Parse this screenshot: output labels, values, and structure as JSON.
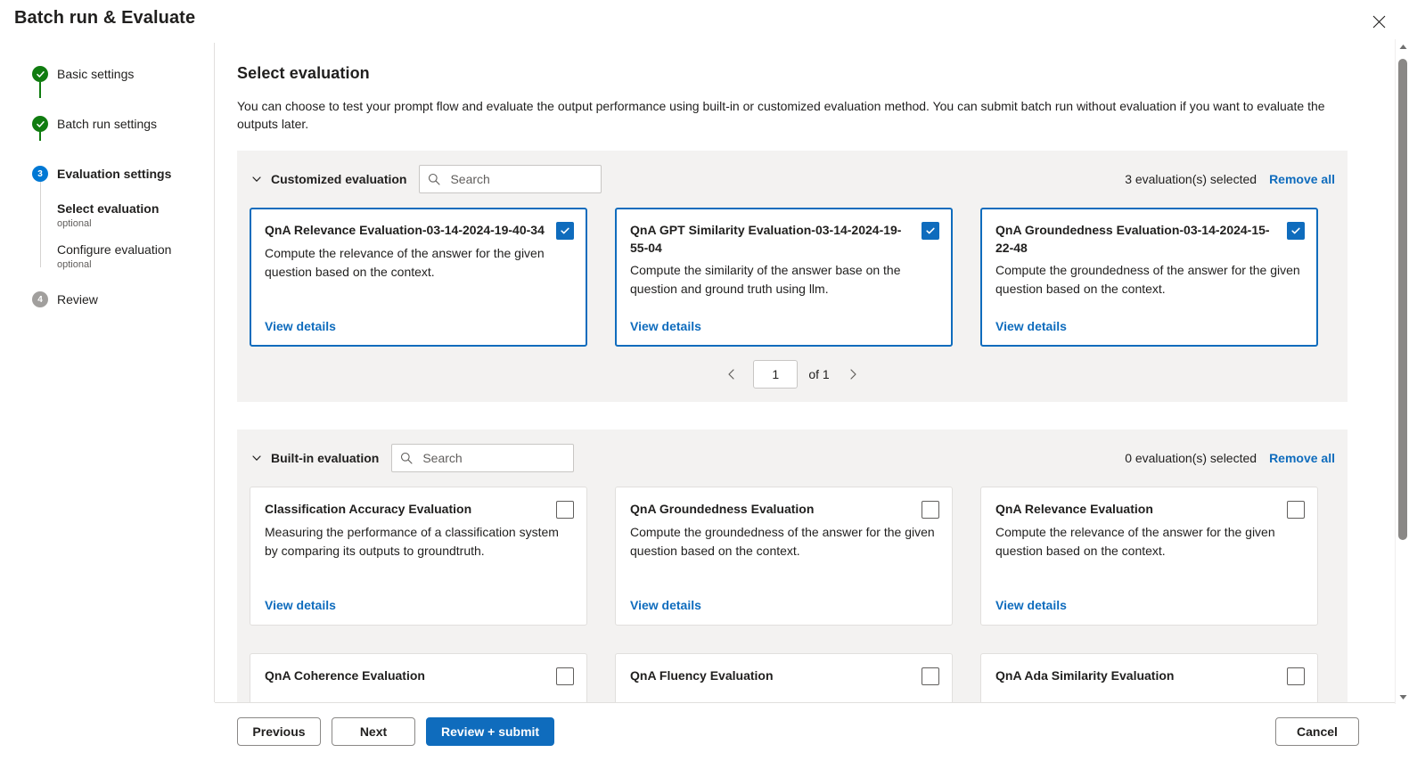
{
  "header": {
    "title": "Batch run & Evaluate",
    "close_icon": "close-icon"
  },
  "sidebar": {
    "steps": [
      {
        "label": "Basic settings",
        "state": "done",
        "marker": "check-icon"
      },
      {
        "label": "Batch run settings",
        "state": "done",
        "marker": "check-icon"
      },
      {
        "label": "Evaluation settings",
        "state": "active",
        "marker": "3"
      }
    ],
    "substeps": [
      {
        "title": "Select evaluation",
        "optional": "optional",
        "active": true
      },
      {
        "title": "Configure evaluation",
        "optional": "optional",
        "active": false
      }
    ],
    "final_step": {
      "label": "Review",
      "state": "future",
      "marker": "4"
    }
  },
  "main": {
    "title": "Select evaluation",
    "description": "You can choose to test your prompt flow and evaluate the output performance using built-in or customized evaluation method. You can submit batch run without evaluation if you want to evaluate the outputs later."
  },
  "customized": {
    "section_label": "Customized evaluation",
    "chevron_icon": "chevron-down-icon",
    "search_placeholder": "Search",
    "search_value": "",
    "search_icon": "search-icon",
    "selected_text": "3 evaluation(s) selected",
    "remove_all_label": "Remove all",
    "cards": [
      {
        "title": "QnA Relevance Evaluation-03-14-2024-19-40-34",
        "description": "Compute the relevance of the answer for the given question based on the context.",
        "link_label": "View details",
        "checked": true
      },
      {
        "title": "QnA GPT Similarity Evaluation-03-14-2024-19-55-04",
        "description": "Compute the similarity of the answer base on the question and ground truth using llm.",
        "link_label": "View details",
        "checked": true
      },
      {
        "title": "QnA Groundedness Evaluation-03-14-2024-15-22-48",
        "description": "Compute the groundedness of the answer for the given question based on the context.",
        "link_label": "View details",
        "checked": true
      }
    ],
    "pager": {
      "prev_icon": "chevron-left-icon",
      "next_icon": "chevron-right-icon",
      "page_value": "1",
      "of_label": "of 1"
    }
  },
  "builtin": {
    "section_label": "Built-in evaluation",
    "chevron_icon": "chevron-down-icon",
    "search_placeholder": "Search",
    "search_value": "",
    "search_icon": "search-icon",
    "selected_text": "0 evaluation(s) selected",
    "remove_all_label": "Remove all",
    "cards": [
      {
        "title": "Classification Accuracy Evaluation",
        "description": "Measuring the performance of a classification system by comparing its outputs to groundtruth.",
        "link_label": "View details",
        "checked": false
      },
      {
        "title": "QnA Groundedness Evaluation",
        "description": "Compute the groundedness of the answer for the given question based on the context.",
        "link_label": "View details",
        "checked": false
      },
      {
        "title": "QnA Relevance Evaluation",
        "description": "Compute the relevance of the answer for the given question based on the context.",
        "link_label": "View details",
        "checked": false
      }
    ],
    "partial_cards": [
      {
        "title": "QnA Coherence Evaluation",
        "checked": false
      },
      {
        "title": "QnA Fluency Evaluation",
        "checked": false
      },
      {
        "title": "QnA Ada Similarity Evaluation",
        "checked": false
      }
    ]
  },
  "footer": {
    "previous_label": "Previous",
    "next_label": "Next",
    "submit_label": "Review + submit",
    "cancel_label": "Cancel"
  },
  "colors": {
    "accent": "#0f6cbd",
    "success": "#107c10",
    "neutral": "#a19f9d",
    "panel": "#f3f2f1"
  }
}
